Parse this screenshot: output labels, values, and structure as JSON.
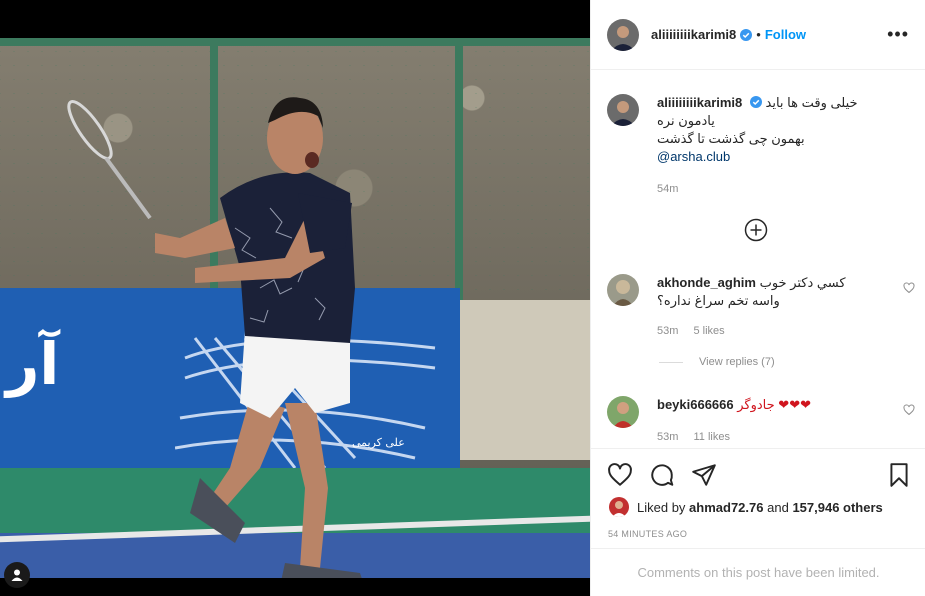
{
  "post": {
    "username": "aliiiiiiiikarimi8",
    "separator": "•",
    "follow_label": "Follow",
    "more_icon": "more-horizontal-icon",
    "photo_signature": "علی کریمی"
  },
  "caption": {
    "username": "aliiiiiiiikarimi8",
    "lines": [
      "خیلی وقت ها باید",
      "یادمون نره",
      "بهمون چی گذشت تا گذشت"
    ],
    "mention": "@arsha.club",
    "time": "54m"
  },
  "comments": [
    {
      "username": "akhonde_aghim",
      "text_line1": "کسي دکتر خوب",
      "text_line2": "واسه تخم سراغ نداره؟",
      "time": "53m",
      "likes": "5 likes",
      "view_replies": "View replies (7)"
    },
    {
      "username": "beyki666666",
      "text": "جادوگر ❤❤❤",
      "time": "53m",
      "likes": "11 likes"
    }
  ],
  "actions": {
    "liked_by_prefix": "Liked by",
    "liked_by_user": "ahmad72.76",
    "liked_by_and": "and",
    "liked_by_count": "157,946 others",
    "posted_ago": "54 MINUTES AGO",
    "comments_limited": "Comments on this post have been limited."
  },
  "colors": {
    "accent": "#0095f6",
    "verified": "#3897f0",
    "heart_red": "#ed4956"
  }
}
